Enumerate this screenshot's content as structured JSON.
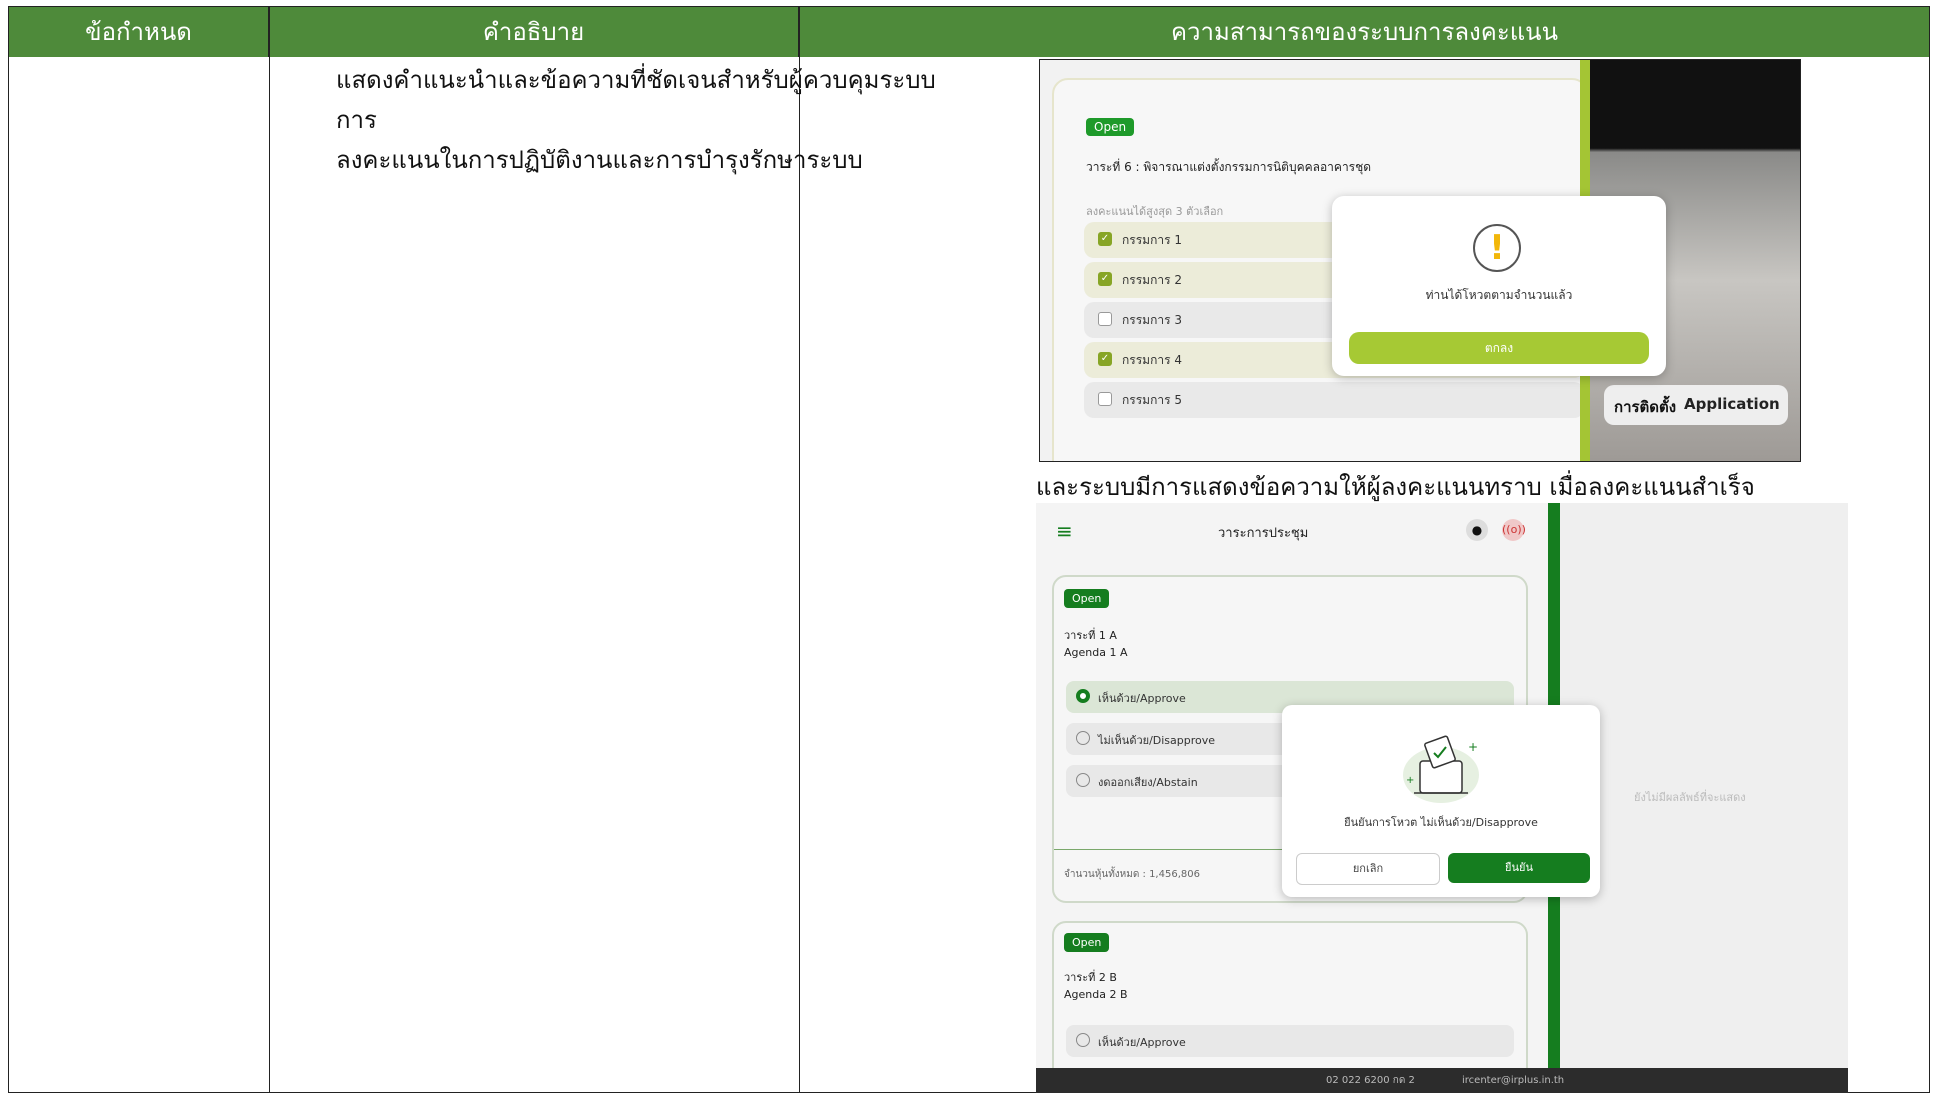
{
  "table": {
    "headers": [
      "ข้อกำหนด",
      "คำอธิบาย",
      "ความสามารถของระบบการลงคะแนน"
    ],
    "description_line1": "แสดงคำแนะนำและข้อความที่ชัดเจนสำหรับผู้ควบคุมระบบการ",
    "description_line2": "ลงคะแนนในการปฏิบัติงานและการบำรุงรักษาระบบ",
    "caption": "และระบบมีการแสดงข้อความให้ผู้ลงคะแนนทราบ เมื่อลงคะแนนสำเร็จ"
  },
  "screenshot1": {
    "badge": "Open",
    "title": "วาระที่ 6 : พิจารณาแต่งตั้งกรรมการนิติบุคคลอาคารชุด",
    "hint": "ลงคะแนนได้สูงสุด 3 ตัวเลือก",
    "options": [
      {
        "label": "กรรมการ 1",
        "checked": true
      },
      {
        "label": "กรรมการ 2",
        "checked": true
      },
      {
        "label": "กรรมการ 3",
        "checked": false
      },
      {
        "label": "กรรมการ 4",
        "checked": true
      },
      {
        "label": "กรรมการ 5",
        "checked": false
      }
    ],
    "check_mark": "✓",
    "modal_icon": "!",
    "modal_message": "ท่านได้โหวตตามจำนวนแล้ว",
    "modal_button": "ตกลง",
    "banner_a": "การติดตั้ง",
    "banner_b": "Application",
    "accent_color": "#a6c934"
  },
  "screenshot2": {
    "menu_icon": "≡",
    "header_title": "วาระการประชุม",
    "icon_chat": "●",
    "icon_live": "((o))",
    "agenda1": {
      "badge": "Open",
      "line1": "วาระที่ 1 A",
      "line2": "Agenda 1 A",
      "options": [
        "เห็นด้วย/Approve",
        "ไม่เห็นด้วย/Disapprove",
        "งดออกเสียง/Abstain"
      ],
      "total": "จำนวนหุ้นทั้งหมด : 1,456,806"
    },
    "agenda2": {
      "badge": "Open",
      "line1": "วาระที่ 2 B",
      "line2": "Agenda 2 B",
      "options": [
        "เห็นด้วย/Approve"
      ]
    },
    "empty_text": "ยังไม่มีผลลัพธ์ที่จะแสดง",
    "modal_message": "ยืนยันการโหวต ไม่เห็นด้วย/Disapprove",
    "cancel": "ยกเลิก",
    "confirm": "ยืนยัน",
    "footer_phone": "02 022 6200 กด 2",
    "footer_email": "ircenter@irplus.in.th",
    "accent_color": "#157d1f"
  }
}
